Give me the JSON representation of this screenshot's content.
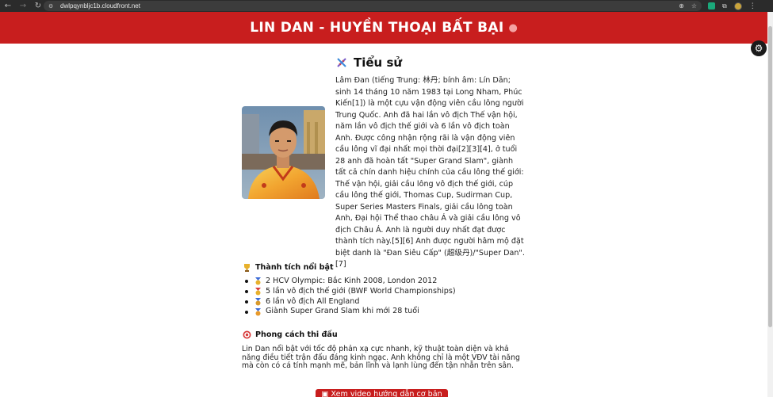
{
  "browser": {
    "url": "dwlpqynbljc1b.cloudfront.net",
    "back_icon": "back-arrow-icon",
    "forward_icon": "forward-arrow-icon",
    "reload_icon": "reload-icon"
  },
  "header": {
    "title": "LIN DAN - HUYỀN THOẠI BẤT BẠI",
    "icon": "badminton-racket-icon",
    "background": "#c81e1e"
  },
  "bio": {
    "title": "Tiểu sử",
    "icon": "dna-icon",
    "text": "Lâm Đan (tiếng Trung: 林丹; bính âm: Lín Dān; sinh 14 tháng 10 năm 1983 tại Long Nham, Phúc Kiến[1]) là một cựu vận động viên cầu lông người Trung Quốc. Anh đã hai lần vô địch Thế vận hội, năm lần vô địch thế giới và 6 lần vô địch toàn Anh. Được công nhận rộng rãi là vận động viên cầu lông vĩ đại nhất mọi thời đại[2][3][4], ở tuổi 28 anh đã hoàn tất \"Super Grand Slam\", giành tất cả chín danh hiệu chính của cầu lông thế giới: Thế vận hội, giải cầu lông vô địch thế giới, cúp cầu lông thế giới, Thomas Cup, Sudirman Cup, Super Series Masters Finals, giải cầu lông toàn Anh, Đại hội Thể thao châu Á và giải cầu lông vô địch Châu Á. Anh là người duy nhất đạt được thành tích này.[5][6] Anh được người hâm mộ đặt biệt danh là \"Đan Siêu Cấp\" (超级丹)/\"Super Dan\".[7]"
  },
  "achievements": {
    "title": "Thành tích nổi bật",
    "icon": "trophy-icon",
    "items": [
      {
        "text": "2 HCV Olympic: Bắc Kinh 2008, London 2012",
        "icon": "medal-icon"
      },
      {
        "text": "5 lần vô địch thế giới (BWF World Championships)",
        "icon": "medal-icon"
      },
      {
        "text": "6 lần vô địch All England",
        "icon": "medal-icon"
      },
      {
        "text": "Giành Super Grand Slam khi mới 28 tuổi",
        "icon": "medal-icon"
      }
    ]
  },
  "play_style": {
    "title": "Phong cách thi đấu",
    "icon": "target-icon",
    "text": "Lin Dan nổi bật với tốc độ phản xạ cực nhanh, kỹ thuật toàn diện và khả năng điều tiết trận đấu đáng kinh ngạc. Anh không chỉ là một VĐV tài năng mà còn có cá tính mạnh mẽ, bản lĩnh và lạnh lùng đến tận nhẫn trên sân."
  },
  "video_button": {
    "label": "Xem video hướng dẫn cơ bản",
    "icon": "video-icon"
  },
  "colors": {
    "accent": "#c81e1e"
  }
}
